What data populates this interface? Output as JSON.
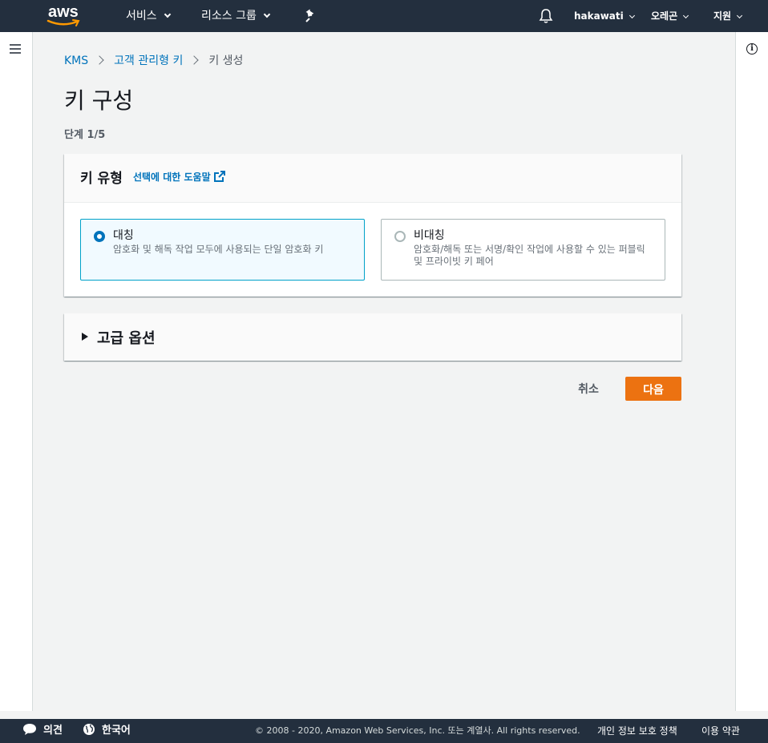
{
  "topnav": {
    "logo_text": "aws",
    "services_label": "서비스",
    "resource_groups_label": "리소스 그룹",
    "account_label": "hakawati",
    "region_label": "오레곤",
    "support_label": "지원"
  },
  "breadcrumb": {
    "items": [
      "KMS",
      "고객 관리형 키",
      "키 생성"
    ]
  },
  "page": {
    "title": "키 구성",
    "step": "단계 1/5"
  },
  "key_type_panel": {
    "title": "키 유형",
    "help_link": "선택에 대한 도움말",
    "options": [
      {
        "label": "대칭",
        "description": "암호화 및 해독 작업 모두에 사용되는 단일 암호화 키",
        "selected": true
      },
      {
        "label": "비대칭",
        "description": "암호화/해독 또는 서명/확인 작업에 사용할 수 있는 퍼블릭 및 프라이빗 키 페어",
        "selected": false
      }
    ]
  },
  "advanced_panel": {
    "title": "고급 옵션"
  },
  "actions": {
    "cancel_label": "취소",
    "next_label": "다음"
  },
  "footer": {
    "feedback_label": "의견",
    "language_label": "한국어",
    "copyright": "© 2008 - 2020, Amazon Web Services, Inc. 또는 계열사. All rights reserved.",
    "privacy_label": "개인 정보 보호 정책",
    "terms_label": "이용 약관"
  },
  "colors": {
    "nav_bg": "#232f3e",
    "link": "#0073bb",
    "primary_button": "#ec7211",
    "selected_border": "#00a1c9"
  }
}
